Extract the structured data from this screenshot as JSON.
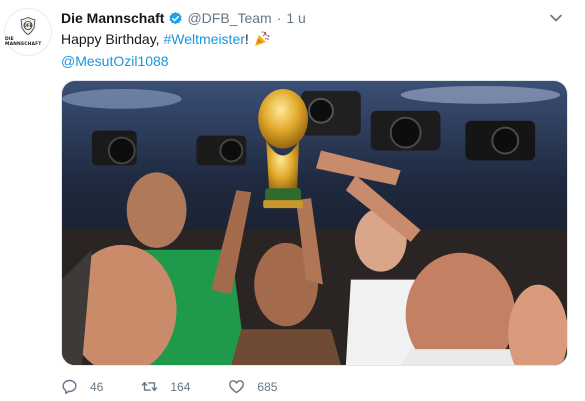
{
  "account": {
    "display_name": "Die Mannschaft",
    "handle": "@DFB_Team",
    "separator": "·",
    "time": "1 u",
    "avatar_text": "DIE MANNSCHAFT"
  },
  "tweet": {
    "text_prefix": "Happy Birthday, ",
    "hashtag": "#Weltmeister",
    "text_suffix": "!",
    "mention": "@MesutOzil1088"
  },
  "actions": {
    "replies": "46",
    "retweets": "164",
    "likes": "685"
  },
  "colors": {
    "link": "#1b95e0",
    "muted": "#657786",
    "verified": "#1da1f2"
  },
  "icons": [
    "chevron-down-icon",
    "verified-icon",
    "party-popper-icon",
    "reply-icon",
    "retweet-icon",
    "like-icon"
  ]
}
